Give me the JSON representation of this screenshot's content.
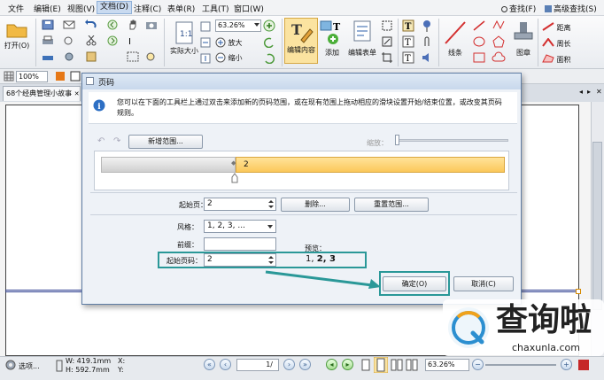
{
  "menu": {
    "items": [
      "文件",
      "编辑(E)",
      "视图(V)",
      "文档(D)",
      "注释(C)",
      "表单(R)",
      "工具(T)",
      "窗口(W)"
    ],
    "active_index": 3,
    "right": {
      "find": "查找(F)",
      "adv_find": "高级查找(S)"
    }
  },
  "ribbon": {
    "open": "打开(O)",
    "actual_size": "实际大小",
    "zoom": "63.26%",
    "zoom_in": "放大",
    "zoom_out": "缩小",
    "edit_content": "编辑内容",
    "add": "添加",
    "edit_form": "编辑表单",
    "lines": "线条",
    "stamp": "图章",
    "distance": "距离",
    "perimeter": "周长",
    "area": "面积"
  },
  "toolbar2": {
    "zoom": "100%"
  },
  "tab": {
    "label": "68个经典管理小故事"
  },
  "dialog": {
    "title": "页码",
    "info": "您可以在下面的工具栏上通过双击来添加新的页码范围，或在现有范围上拖动相应的滑块设置开始/结束位置，或改变其页码规则。",
    "new_range": "新增范围...",
    "scale_label": "缩放：",
    "range_marker": "2",
    "start_page_label": "起始页：",
    "start_page_value": "2",
    "delete_button": "删除...",
    "reset_button": "重置范围...",
    "style_label": "风格：",
    "style_value": "1, 2, 3, ...",
    "prefix_label": "前缀：",
    "prefix_value": "",
    "preview_label": "预览：",
    "start_number_label": "起始页码：",
    "start_number_value": "2",
    "preview_prefix": "1,",
    "preview_bold": "2, 3",
    "ok_button": "确定(O)",
    "cancel_button": "取消(C)"
  },
  "statusbar": {
    "options": "选项...",
    "width": "W: 419.1mm",
    "height": "H: 592.7mm",
    "x": "X:",
    "y": "Y:",
    "page": "1",
    "page_suffix": "/",
    "zoom": "63.26%"
  },
  "watermark": {
    "text": "查询啦",
    "url": "chaxunla.com"
  },
  "colors": {
    "accent": "#2a9898",
    "range": "#fbc85a",
    "dialog_bg": "#eef2f7"
  }
}
